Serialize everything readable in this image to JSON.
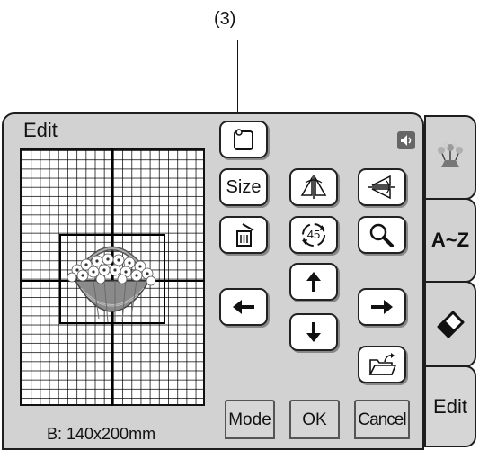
{
  "callout": {
    "label": "(3)"
  },
  "panel": {
    "title": "Edit"
  },
  "status": {
    "text": "B: 140x200mm"
  },
  "buttons": {
    "size_label": "Size",
    "mode_label": "Mode",
    "ok_label": "OK",
    "cancel_label": "Cancel",
    "rotate_label": "45"
  },
  "tabs": {
    "alpha_label": "A~Z",
    "edit_label": "Edit"
  },
  "icons": {
    "frame": "frame-icon",
    "mirror_vertical": "mirror-vertical-icon",
    "mirror_horizontal": "mirror-horizontal-icon",
    "delete": "delete-icon",
    "rotate": "rotate-icon",
    "zoom": "magnifier-icon",
    "up": "arrow-up-icon",
    "down": "arrow-down-icon",
    "left": "arrow-left-icon",
    "right": "arrow-right-icon",
    "open": "open-folder-icon",
    "speaker": "speaker-icon",
    "eraser": "eraser-icon",
    "flowers": "flower-thumbnail-icon"
  }
}
